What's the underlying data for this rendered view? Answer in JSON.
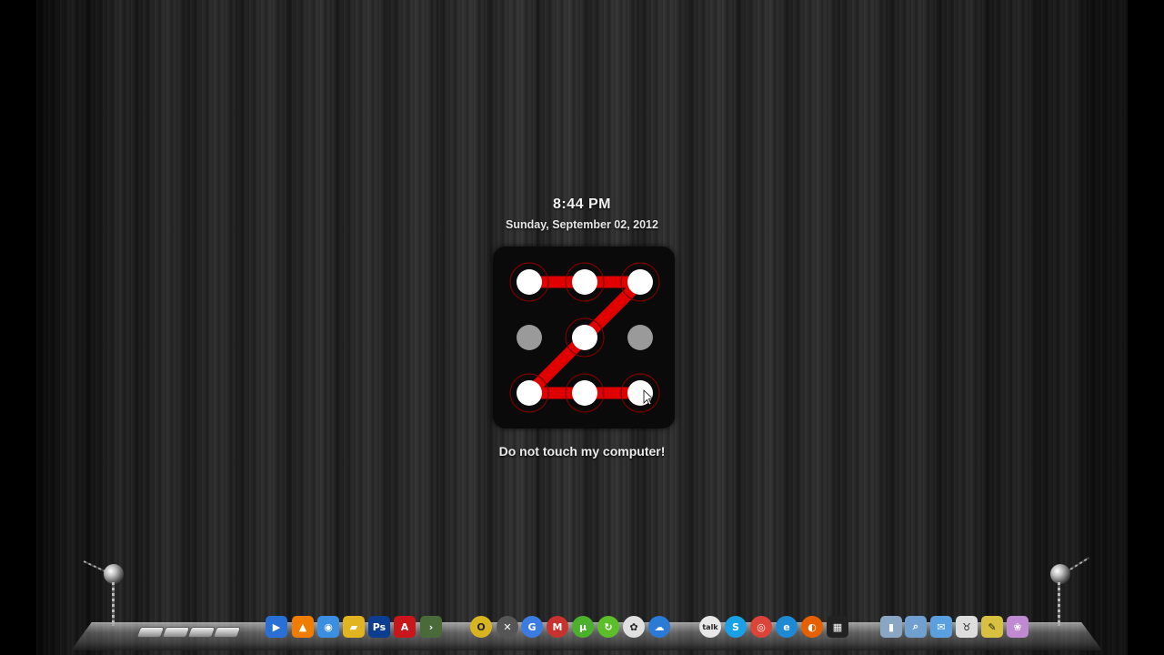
{
  "lock_screen": {
    "time": "8:44 PM",
    "date": "Sunday, September 02, 2012",
    "message": "Do not touch my computer!"
  },
  "pattern": {
    "grid": 3,
    "path": [
      0,
      1,
      2,
      4,
      6,
      7,
      8
    ],
    "selected_dots": [
      0,
      1,
      2,
      4,
      6,
      7,
      8
    ],
    "line_color": "#e00000",
    "dot_active_color": "#ffffff",
    "dot_inactive_color": "#9a9a9a"
  },
  "dock": {
    "drives": [
      "drive-1",
      "drive-2",
      "drive-3",
      "drive-4"
    ],
    "icons": [
      {
        "name": "media-player-icon",
        "glyph": "▶",
        "color": "#2a6fd6"
      },
      {
        "name": "vlc-icon",
        "glyph": "▲",
        "color": "#f07d00"
      },
      {
        "name": "itunes-icon",
        "glyph": "◉",
        "color": "#3b8fe0"
      },
      {
        "name": "folder-icon",
        "glyph": "▰",
        "color": "#e2b420"
      },
      {
        "name": "photoshop-icon",
        "glyph": "Ps",
        "color": "#0b3d91"
      },
      {
        "name": "acrobat-icon",
        "glyph": "A",
        "color": "#c9161b"
      },
      {
        "name": "terminal-icon",
        "glyph": "›",
        "color": "#4a6a3a"
      },
      {
        "name": "opera-icon",
        "glyph": "O",
        "color": "#d8b520"
      },
      {
        "name": "compass-icon",
        "glyph": "✕",
        "color": "#555555"
      },
      {
        "name": "google-icon",
        "glyph": "G",
        "color": "#3c7be0"
      },
      {
        "name": "gmail-icon",
        "glyph": "M",
        "color": "#c8322e"
      },
      {
        "name": "utorrent-icon",
        "glyph": "µ",
        "color": "#4bb02b"
      },
      {
        "name": "refresh-icon",
        "glyph": "↻",
        "color": "#5cbf2a"
      },
      {
        "name": "picasa-icon",
        "glyph": "✿",
        "color": "#e0e0e0"
      },
      {
        "name": "cloud-icon",
        "glyph": "☁",
        "color": "#2b7ad6"
      },
      {
        "name": "gtalk-icon",
        "glyph": "talk",
        "color": "#e8e8e8"
      },
      {
        "name": "skype-icon",
        "glyph": "S",
        "color": "#1aa0e6"
      },
      {
        "name": "chrome-icon",
        "glyph": "◎",
        "color": "#db4437"
      },
      {
        "name": "ie-icon",
        "glyph": "e",
        "color": "#1e8ad6"
      },
      {
        "name": "firefox-icon",
        "glyph": "◐",
        "color": "#e66000"
      },
      {
        "name": "grid-app-icon",
        "glyph": "▦",
        "color": "#222222"
      },
      {
        "name": "trash-icon",
        "glyph": "▮",
        "color": "#8aa6c4"
      },
      {
        "name": "finder-icon",
        "glyph": "⌕",
        "color": "#6fa0d0"
      },
      {
        "name": "mail-icon",
        "glyph": "✉",
        "color": "#5aa0e0"
      },
      {
        "name": "cow-icon",
        "glyph": "♉",
        "color": "#dddddd"
      },
      {
        "name": "tools-icon",
        "glyph": "✎",
        "color": "#d8c040"
      },
      {
        "name": "flowers-icon",
        "glyph": "❀",
        "color": "#c08ad0"
      }
    ]
  }
}
